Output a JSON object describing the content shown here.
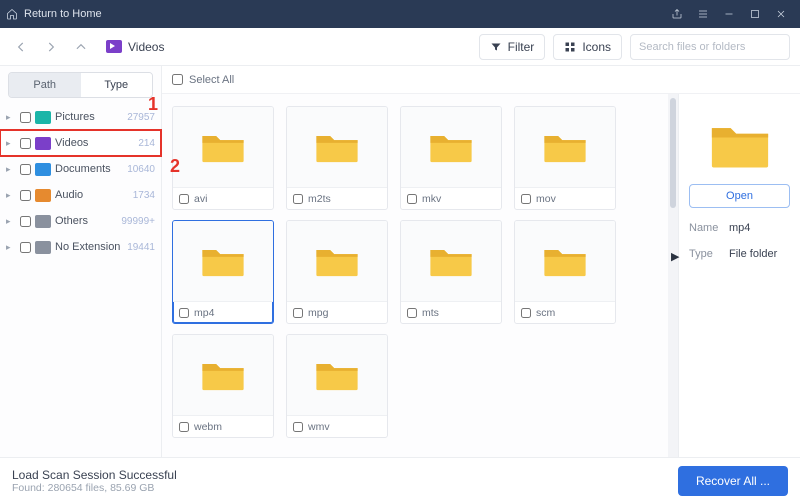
{
  "titlebar": {
    "return_label": "Return to Home"
  },
  "toolbar": {
    "crumb_label": "Videos",
    "filter_label": "Filter",
    "view_label": "Icons",
    "search_placeholder": "Search files or folders"
  },
  "sidebar": {
    "tabs": {
      "path": "Path",
      "type": "Type",
      "active": "path"
    },
    "items": [
      {
        "label": "Pictures",
        "count": "27957",
        "color": "teal"
      },
      {
        "label": "Videos",
        "count": "214",
        "color": "purple",
        "highlight": true
      },
      {
        "label": "Documents",
        "count": "10640",
        "color": "blue"
      },
      {
        "label": "Audio",
        "count": "1734",
        "color": "orange"
      },
      {
        "label": "Others",
        "count": "99999+",
        "color": "gray"
      },
      {
        "label": "No Extension",
        "count": "19441",
        "color": "gray"
      }
    ]
  },
  "annotations": {
    "one": "1",
    "two": "2"
  },
  "main": {
    "select_all_label": "Select All",
    "folders": [
      {
        "name": "avi"
      },
      {
        "name": "m2ts"
      },
      {
        "name": "mkv"
      },
      {
        "name": "mov"
      },
      {
        "name": "mp4",
        "selected": true
      },
      {
        "name": "mpg"
      },
      {
        "name": "mts"
      },
      {
        "name": "scm"
      },
      {
        "name": "webm"
      },
      {
        "name": "wmv"
      }
    ]
  },
  "details": {
    "open_label": "Open",
    "name_key": "Name",
    "name_val": "mp4",
    "type_key": "Type",
    "type_val": "File folder"
  },
  "footer": {
    "title": "Load Scan Session Successful",
    "subtitle": "Found: 280654 files, 85.69 GB",
    "recover_label": "Recover All ..."
  }
}
